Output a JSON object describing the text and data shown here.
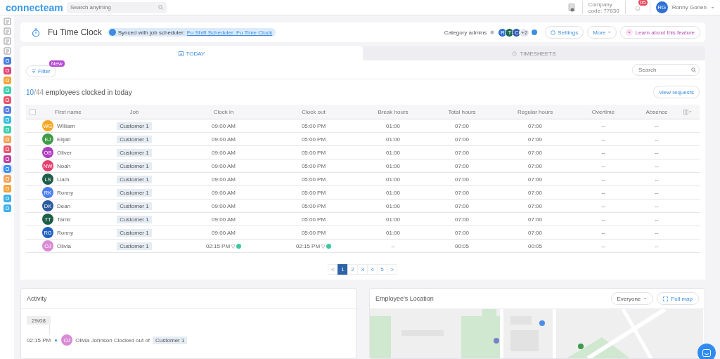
{
  "topbar": {
    "logo": "connecteam",
    "search": {
      "placeholder": "Search anything"
    },
    "company_label": "Company",
    "company_code": "code: 77830",
    "notifications": "05",
    "user": {
      "initials": "RG",
      "name": "Ronny Gonen"
    }
  },
  "sidebar": {
    "items": [
      {
        "kind": "tool",
        "selected": false
      },
      {
        "kind": "tool",
        "selected": false
      },
      {
        "kind": "tool",
        "selected": false
      },
      {
        "kind": "tool",
        "selected": false
      },
      {
        "kind": "app",
        "color": "#4a7fe0",
        "selected": false
      },
      {
        "kind": "app",
        "color": "#e0457a",
        "selected": false
      },
      {
        "kind": "app",
        "color": "#f5a33a",
        "selected": false
      },
      {
        "kind": "app",
        "color": "#3ccfae",
        "selected": false
      },
      {
        "kind": "app",
        "color": "#e8566e",
        "selected": false
      },
      {
        "kind": "app",
        "color": "#5a7de0",
        "selected": false
      },
      {
        "kind": "app",
        "color": "#3bbde0",
        "selected": false
      },
      {
        "kind": "app",
        "color": "#3ccfae",
        "selected": false
      },
      {
        "kind": "app",
        "color": "#f5a35a",
        "selected": false
      },
      {
        "kind": "app",
        "color": "#e8566e",
        "selected": false
      },
      {
        "kind": "app",
        "color": "#c040a0",
        "selected": false
      },
      {
        "kind": "app",
        "color": "#3b8ef0",
        "selected": true
      },
      {
        "kind": "app",
        "color": "#f5a35a",
        "selected": false
      },
      {
        "kind": "app",
        "color": "#f5a33a",
        "selected": false
      },
      {
        "kind": "app",
        "color": "#3bb0e8",
        "selected": false
      },
      {
        "kind": "app",
        "color": "#3bb0e8",
        "selected": false
      }
    ]
  },
  "header": {
    "title": "Fu Time Clock",
    "sync_text": "Synced with job scheduler:",
    "sync_link": "Fu Shift Scheduler: Fu Time Clock",
    "admins_label": "Category admins",
    "admins": [
      {
        "initials": "R",
        "color": "#2f6fd6"
      },
      {
        "initials": "T",
        "color": "#1f6b52"
      },
      {
        "initials": "C",
        "color": "#2f5fb0"
      }
    ],
    "admins_more": "+2",
    "buttons": [
      {
        "kind": "settings",
        "label": "Settings"
      },
      {
        "kind": "dropdown",
        "label": "More"
      },
      {
        "kind": "video",
        "label": "Learn about this feature"
      }
    ]
  },
  "tabs": [
    {
      "label": "TODAY",
      "selected": true
    },
    {
      "label": "TIMESHEETS",
      "selected": false
    }
  ],
  "filter": {
    "label": "Filter",
    "badge": "New"
  },
  "search": {
    "placeholder": "Search"
  },
  "summary": {
    "clocked": "10",
    "total": "/44",
    "text": "employees clocked in today"
  },
  "view_requests": "View requests",
  "table": {
    "select_all": {
      "checked": false
    },
    "columns": [
      "First name",
      "Job",
      "Clock in",
      "Clock out",
      "Break hours",
      "Total hours",
      "Regular hours",
      "Overtime",
      "Absence"
    ],
    "rows": [
      {
        "initials": "WG",
        "color": "#f5a623",
        "name": "William",
        "job": "Customer 1",
        "clock_in": "09:00 AM",
        "clock_out": "05:00 PM",
        "geo": false,
        "break": "01:00",
        "total": "07:00",
        "regular": "07:00",
        "overtime": "--",
        "absence": "--"
      },
      {
        "initials": "EJ",
        "color": "#3f9b45",
        "name": "Elijah",
        "job": "Customer 1",
        "clock_in": "09:00 AM",
        "clock_out": "05:00 PM",
        "geo": false,
        "break": "01:00",
        "total": "07:00",
        "regular": "07:00",
        "overtime": "--",
        "absence": "--"
      },
      {
        "initials": "OB",
        "color": "#b03bc0",
        "name": "Oliver",
        "job": "Customer 1",
        "clock_in": "09:00 AM",
        "clock_out": "05:00 PM",
        "geo": false,
        "break": "01:00",
        "total": "07:00",
        "regular": "07:00",
        "overtime": "--",
        "absence": "--"
      },
      {
        "initials": "NW",
        "color": "#e63d6f",
        "name": "Noah",
        "job": "Customer 1",
        "clock_in": "09:00 AM",
        "clock_out": "05:00 PM",
        "geo": false,
        "break": "01:00",
        "total": "07:00",
        "regular": "07:00",
        "overtime": "--",
        "absence": "--"
      },
      {
        "initials": "LS",
        "color": "#1d5e48",
        "name": "Liam",
        "job": "Customer 1",
        "clock_in": "09:00 AM",
        "clock_out": "05:00 PM",
        "geo": false,
        "break": "01:00",
        "total": "07:00",
        "regular": "07:00",
        "overtime": "--",
        "absence": "--"
      },
      {
        "initials": "RK",
        "color": "#4a7ff0",
        "name": "Ronny",
        "job": "Customer 1",
        "clock_in": "09:00 AM",
        "clock_out": "05:00 PM",
        "geo": false,
        "break": "01:00",
        "total": "07:00",
        "regular": "07:00",
        "overtime": "--",
        "absence": "--"
      },
      {
        "initials": "DK",
        "color": "#2c5aa0",
        "name": "Dean",
        "job": "Customer 1",
        "clock_in": "09:00 AM",
        "clock_out": "05:00 PM",
        "geo": false,
        "break": "01:00",
        "total": "07:00",
        "regular": "07:00",
        "overtime": "--",
        "absence": "--"
      },
      {
        "initials": "TT",
        "color": "#1d5e48",
        "name": "Tamir",
        "job": "Customer 1",
        "clock_in": "09:00 AM",
        "clock_out": "05:00 PM",
        "geo": false,
        "break": "01:00",
        "total": "07:00",
        "regular": "07:00",
        "overtime": "--",
        "absence": "--"
      },
      {
        "initials": "RG",
        "color": "#1f5fc0",
        "name": "Ronny",
        "job": "Customer 1",
        "clock_in": "09:00 AM",
        "clock_out": "05:00 PM",
        "geo": false,
        "break": "01:00",
        "total": "07:00",
        "regular": "07:00",
        "overtime": "--",
        "absence": "--"
      },
      {
        "initials": "OJ",
        "color": "#d98bd6",
        "name": "Olivia",
        "job": "Customer 1",
        "clock_in": "02:15 PM",
        "clock_out": "02:15 PM",
        "geo": true,
        "break": "--",
        "total": "00:05",
        "regular": "00:05",
        "overtime": "--",
        "absence": "--"
      }
    ]
  },
  "pagination": [
    {
      "label": "<",
      "selected": false
    },
    {
      "label": "1",
      "selected": true
    },
    {
      "label": "2",
      "selected": false
    },
    {
      "label": "3",
      "selected": false
    },
    {
      "label": "4",
      "selected": false
    },
    {
      "label": "5",
      "selected": false
    },
    {
      "label": ">",
      "selected": false
    }
  ],
  "activity": {
    "title": "Activity",
    "date": "29/08",
    "entries": [
      {
        "time": "02:15 PM",
        "initials": "OJ",
        "color": "#d98bd6",
        "text": "Olivia Johnson Clocked out of",
        "tag": "Customer 1"
      }
    ]
  },
  "location": {
    "title": "Employee's Location",
    "filter": "Everyone",
    "button": "Full map"
  }
}
